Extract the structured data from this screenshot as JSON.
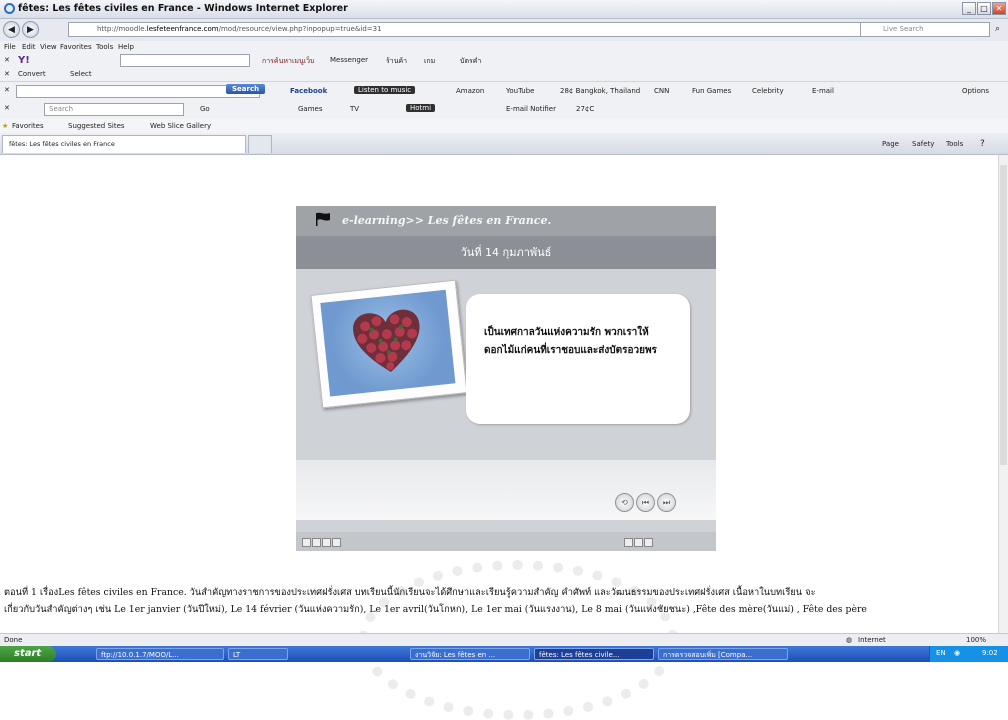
{
  "window": {
    "title": "fêtes: Les fêtes civiles en France - Windows Internet Explorer"
  },
  "address": {
    "url_prefix": "http://moodle.",
    "url_domain": "lesfeteenfrance.com",
    "url_path": "/mod/resource/view.php?inpopup=true&id=31",
    "live_search_placeholder": "Live Search"
  },
  "menu": [
    "File",
    "Edit",
    "View",
    "Favorites",
    "Tools",
    "Help"
  ],
  "toolbar1": {
    "thai_search": "การค้นหาเมนูเว็บ",
    "messenger": "Messenger",
    "news": "ร้านค้า",
    "games": "เกม",
    "contacts": "บัตรคำ"
  },
  "toolbar2": {
    "convert": "Convert",
    "select": "Select"
  },
  "toolbar3": {
    "search_button": "Search",
    "facebook": "Facebook",
    "listen": "Listen to music",
    "amazon": "Amazon",
    "youtube": "YouTube",
    "weather": "28¢ Bangkok, Thailand",
    "cnn": "CNN",
    "fungames": "Fun Games",
    "celebrity": "Celebrity",
    "email": "E-mail",
    "options": "Options"
  },
  "toolbar4": {
    "search_placeholder": "Search",
    "go": "Go",
    "games": "Games",
    "tv": "TV",
    "hotmail": "Hotmi",
    "notifier": "E-mail Notifier",
    "temp": "27¢C"
  },
  "favorites_bar": {
    "favorites": "Favorites",
    "suggested": "Suggested Sites",
    "webslice": "Web Slice Gallery"
  },
  "tabs": [
    {
      "title": "fêtes: Les fêtes civiles en France"
    }
  ],
  "command_bar": {
    "page": "Page",
    "safety": "Safety",
    "tools": "Tools"
  },
  "flash": {
    "header": "e-learning>> Les fêtes en France.",
    "date": "วันที่ 14 กุมภาพันธ์",
    "message_line1": "เป็นเทศกาลวันแห่งความรัก พวกเราให้",
    "message_line2": "ดอกไม้แก่คนที่เราชอบและส่งบัตรอวยพร"
  },
  "body": {
    "line1": "ตอนที่ 1 เรื่องLes fêtes civiles en France. วันสำคัญทางราชการของประเทศฝรั่งเศส บทเรียนนี้นักเรียนจะได้ศึกษาและเรียนรู้ความสำคัญ คำศัพท์ และวัฒนธรรมของประเทศฝรั่งเศส เนื้อหาในบทเรียน จะ",
    "line2": "เกี่ยวกับวันสำคัญต่างๆ เช่น Le 1er janvier (วันปีใหม่), Le 14 février (วันแห่งความรัก), Le 1er avril(วันโกหก), Le 1er mai (วันแรงงาน), Le 8 mai (วันแห่งชัยชนะ) ,Fête des mère(วันแม่) , Fête des père"
  },
  "status": {
    "left": "Done",
    "zone": "Internet",
    "zoom": "100%"
  },
  "taskbar": {
    "start": "start",
    "tasks": [
      "ftp://10.0.1.7/MOO/L...",
      "LT",
      "งานวิจัย: Les fêtes en ...",
      "fêtes: Les fêtes civile...",
      "การตรวจสอบเพิ่ม [Compa..."
    ],
    "lang": "EN",
    "time": "9:02"
  }
}
